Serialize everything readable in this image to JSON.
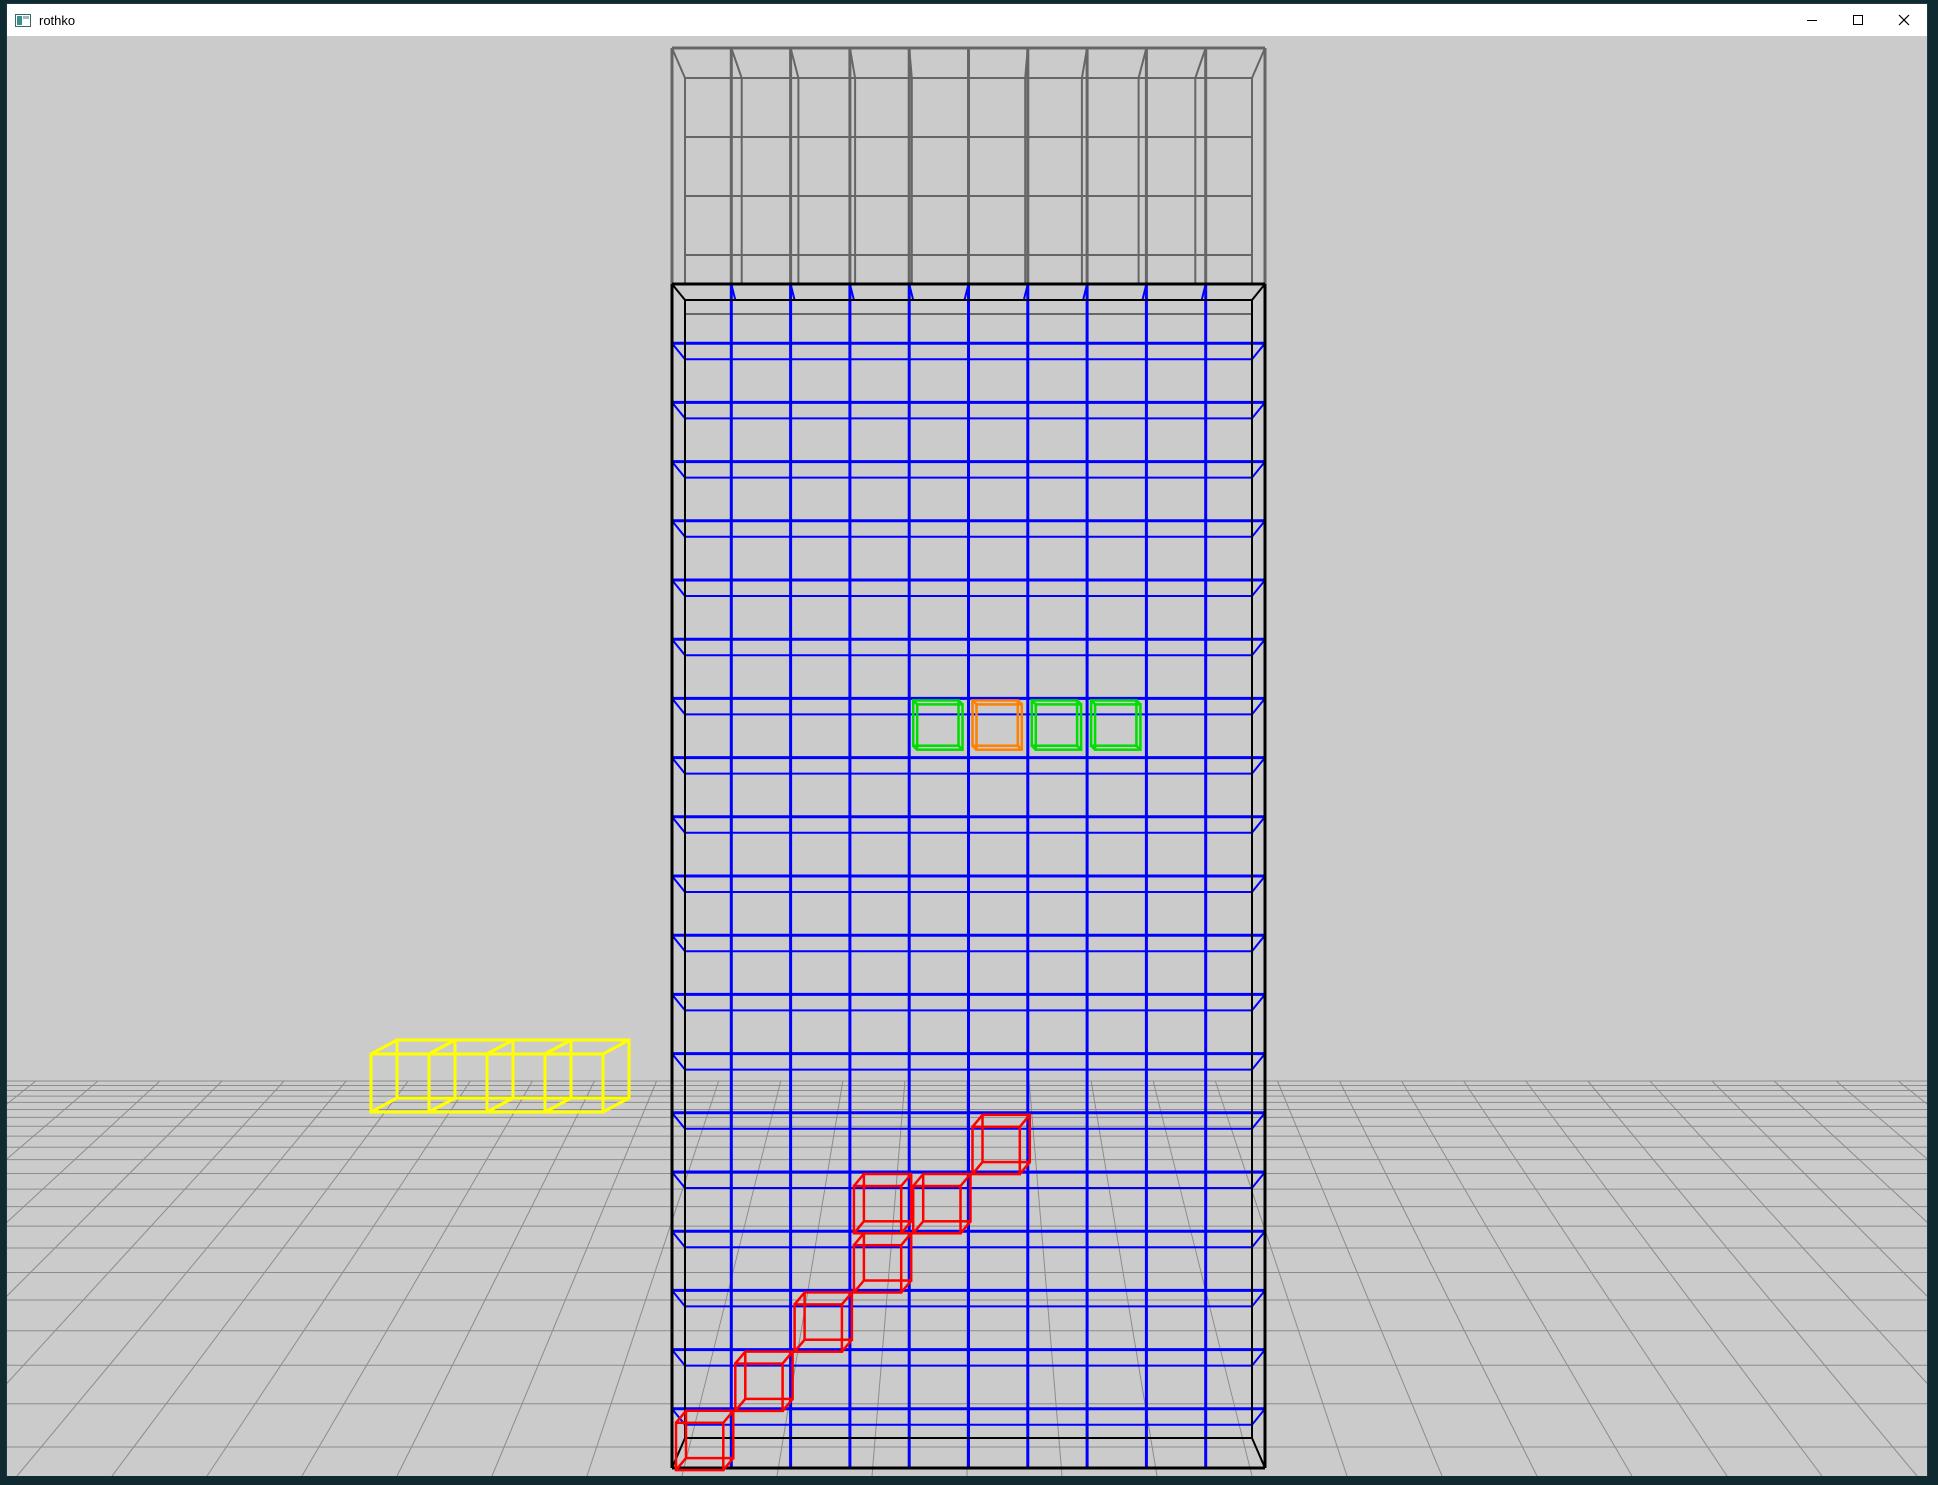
{
  "window": {
    "title": "rothko",
    "icon": "app-window-icon"
  },
  "controls": {
    "minimize_icon": "minimize-icon",
    "maximize_icon": "maximize-icon",
    "close_icon": "close-icon"
  },
  "well": {
    "columns": 10,
    "visible_rows": 20,
    "buffer_rows": 4,
    "wireframe_color": "#0000ff",
    "buffer_color": "#666666",
    "frame_color": "#000000"
  },
  "falling_piece": {
    "shape": "T",
    "cells": [
      [
        4,
        7
      ],
      [
        5,
        7
      ],
      [
        6,
        7
      ],
      [
        7,
        7
      ]
    ],
    "pivot": [
      5,
      7
    ],
    "color": "#00dd00",
    "pivot_color": "#ff8000"
  },
  "next_piece": {
    "shape": "I",
    "cells": 4,
    "color": "#ffff00"
  },
  "placed_blocks": {
    "color": "#ff0000",
    "cells": [
      [
        0,
        0
      ],
      [
        1,
        1
      ],
      [
        2,
        2
      ],
      [
        3,
        3
      ],
      [
        3,
        4
      ],
      [
        4,
        4
      ],
      [
        5,
        5
      ]
    ]
  },
  "colors": {
    "background": "#cbcbcb",
    "floor_grid": "#8c8c8c"
  }
}
